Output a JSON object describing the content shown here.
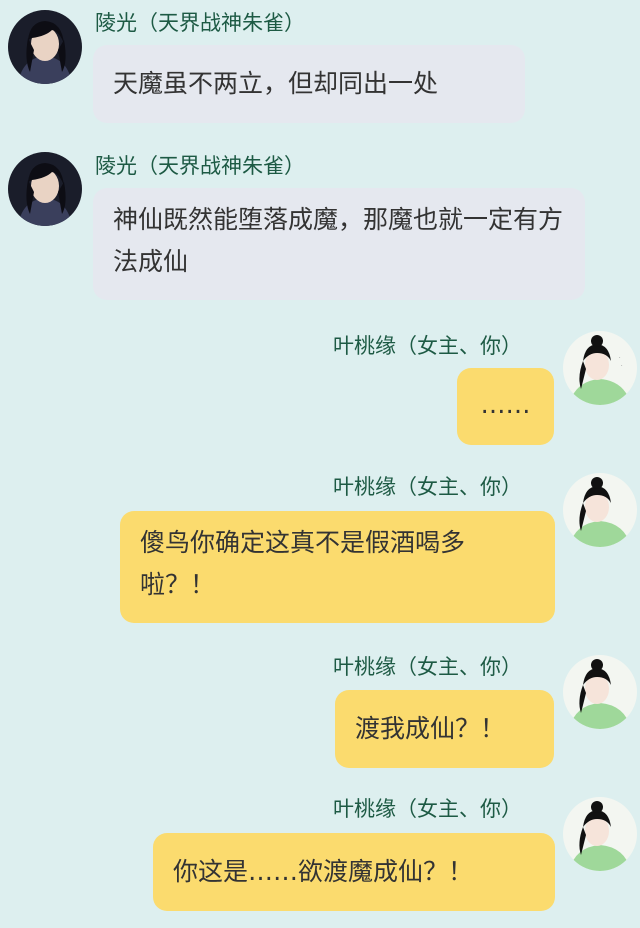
{
  "colors": {
    "background": "#ddefef",
    "left_bubble": "#e5e8ef",
    "right_bubble": "#fbdb6e",
    "name_text": "#1d5a44"
  },
  "messages": [
    {
      "side": "left",
      "sender": "陵光（天界战神朱雀）",
      "text": "天魔虽不两立，但却同出一处",
      "avatar": "male-character-avatar"
    },
    {
      "side": "left",
      "sender": "陵光（天界战神朱雀）",
      "text": "神仙既然能堕落成魔，那魔也就一定有方法成仙",
      "avatar": "male-character-avatar"
    },
    {
      "side": "right",
      "sender": "叶桃缘（女主、你）",
      "text": "……",
      "avatar": "female-character-avatar"
    },
    {
      "side": "right",
      "sender": "叶桃缘（女主、你）",
      "text": "傻鸟你确定这真不是假酒喝多啦？！",
      "avatar": "female-character-avatar"
    },
    {
      "side": "right",
      "sender": "叶桃缘（女主、你）",
      "text": "渡我成仙？！",
      "avatar": "female-character-avatar"
    },
    {
      "side": "right",
      "sender": "叶桃缘（女主、你）",
      "text": "你这是……欲渡魔成仙？！",
      "avatar": "female-character-avatar"
    }
  ]
}
